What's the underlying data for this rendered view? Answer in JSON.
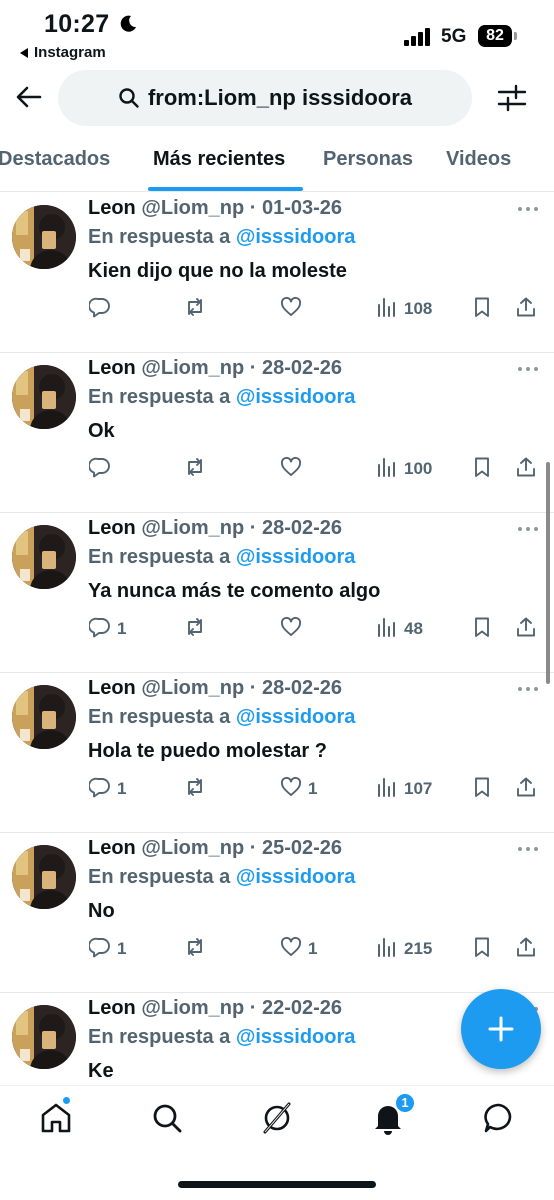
{
  "status_bar": {
    "time": "10:27",
    "back_app": "Instagram",
    "network": "5G",
    "battery": "82"
  },
  "search": {
    "query": "from:Liom_np isssidoora"
  },
  "tabs": [
    {
      "label": "Destacados"
    },
    {
      "label": "Más recientes"
    },
    {
      "label": "Personas"
    },
    {
      "label": "Videos"
    }
  ],
  "tweets": [
    {
      "name": "Leon",
      "handle": "@Liom_np",
      "date": "· 01-03-26",
      "reply_prefix": "En respuesta a",
      "reply_to": "@isssidoora",
      "text": "Kien dijo que no la moleste",
      "replies": "",
      "likes": "",
      "views": "108"
    },
    {
      "name": "Leon",
      "handle": "@Liom_np",
      "date": "· 28-02-26",
      "reply_prefix": "En respuesta a",
      "reply_to": "@isssidoora",
      "text": "Ok",
      "replies": "",
      "likes": "",
      "views": "100"
    },
    {
      "name": "Leon",
      "handle": "@Liom_np",
      "date": "· 28-02-26",
      "reply_prefix": "En respuesta a",
      "reply_to": "@isssidoora",
      "text": "Ya nunca más te comento algo",
      "replies": "1",
      "likes": "",
      "views": "48"
    },
    {
      "name": "Leon",
      "handle": "@Liom_np",
      "date": "· 28-02-26",
      "reply_prefix": "En respuesta a",
      "reply_to": "@isssidoora",
      "text": "Hola te puedo molestar ?",
      "replies": "1",
      "likes": "1",
      "views": "107"
    },
    {
      "name": "Leon",
      "handle": "@Liom_np",
      "date": "· 25-02-26",
      "reply_prefix": "En respuesta a",
      "reply_to": "@isssidoora",
      "text": "No",
      "replies": "1",
      "likes": "1",
      "views": "215"
    },
    {
      "name": "Leon",
      "handle": "@Liom_np",
      "date": "· 22-02-26",
      "reply_prefix": "En respuesta a",
      "reply_to": "@isssidoora",
      "text": "Ke",
      "replies": "",
      "likes": "",
      "views": ""
    }
  ],
  "bottom_nav": {
    "notification_count": "1"
  },
  "colors": {
    "accent": "#1d9bf0",
    "secondary_text": "#536471",
    "primary_text": "#0f1419"
  }
}
